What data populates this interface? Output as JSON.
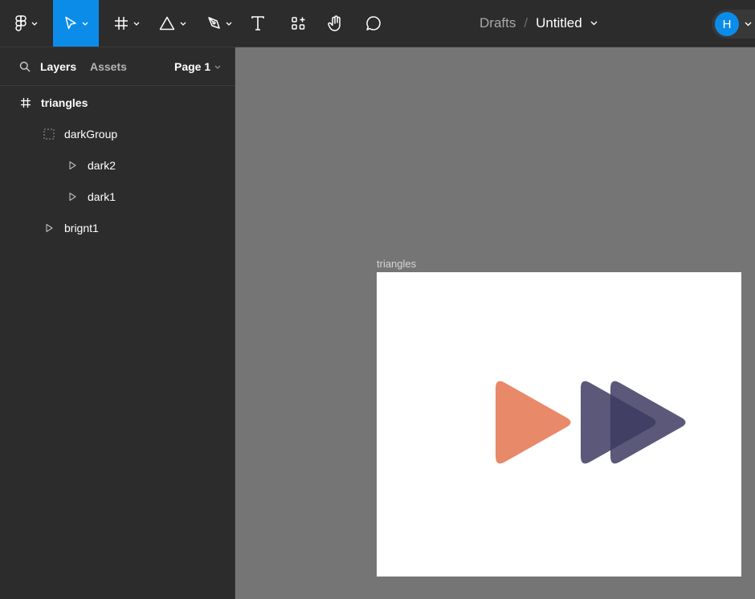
{
  "toolbar": {
    "tools": [
      "main-menu",
      "move",
      "frame",
      "shape",
      "pen",
      "text",
      "resources",
      "hand",
      "comment"
    ],
    "active_tool": "move"
  },
  "header": {
    "breadcrumb": "Drafts",
    "separator": "/",
    "doc_title": "Untitled",
    "avatar_initial": "H"
  },
  "panel": {
    "tabs": {
      "layers": "Layers",
      "assets": "Assets"
    },
    "page": "Page 1",
    "layers": [
      {
        "name": "triangles",
        "icon": "frame-icon"
      },
      {
        "name": "darkGroup",
        "icon": "group-icon"
      },
      {
        "name": "dark2",
        "icon": "triangle-icon"
      },
      {
        "name": "dark1",
        "icon": "triangle-icon"
      },
      {
        "name": "brignt1",
        "icon": "triangle-icon"
      }
    ]
  },
  "canvas": {
    "frame_label": "triangles",
    "colors": {
      "bright": "#e8896a",
      "dark": "#3e3b62",
      "canvas_bg": "#757575",
      "accent": "#0c8ce9"
    }
  }
}
